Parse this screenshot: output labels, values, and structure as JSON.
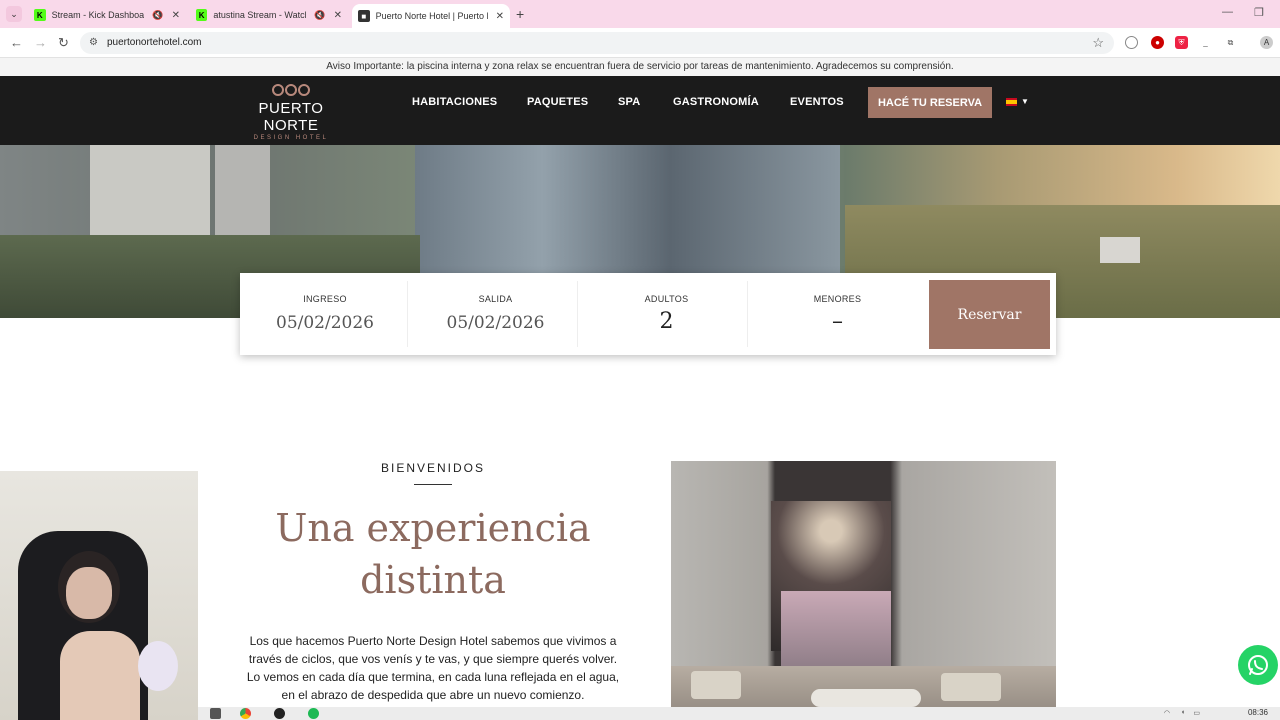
{
  "browser": {
    "tabs": [
      {
        "title": "Stream - Kick Dashboard",
        "favicon": "kick-icon",
        "active": false
      },
      {
        "title": "atustina Stream - Watch Liv",
        "favicon": "kick-icon",
        "active": false
      },
      {
        "title": "Puerto Norte Hotel | Puerto No",
        "favicon": "hotel-icon",
        "active": true
      }
    ],
    "url": "puertonortehotel.com"
  },
  "notice": "Aviso Importante: la piscina interna y zona relax se encuentran fuera de servicio por tareas de mantenimiento. Agradecemos su comprensión.",
  "header": {
    "logo_name": "PUERTO NORTE",
    "logo_sub": "DESIGN HOTEL",
    "nav": [
      "HABITACIONES",
      "PAQUETES",
      "SPA",
      "GASTRONOMÍA",
      "EVENTOS"
    ],
    "cta": "HACÉ TU RESERVA",
    "language": "es"
  },
  "booking": {
    "checkin_label": "INGRESO",
    "checkin_value": "05/02/2026",
    "checkout_label": "SALIDA",
    "checkout_value": "05/02/2026",
    "adults_label": "ADULTOS",
    "adults_value": "2",
    "children_label": "MENORES",
    "children_value": "–",
    "reserve_label": "Reservar"
  },
  "welcome": {
    "kicker": "BIENVENIDOS",
    "headline_line1": "Una experiencia",
    "headline_line2": "distinta",
    "body_line1": "Los que hacemos Puerto Norte Design Hotel sabemos que vivimos a",
    "body_line2": "través de ciclos, que vos venís y te vas, y que siempre querés volver.",
    "body_line3": "Lo vemos en cada día que termina, en cada luna reflejada en el agua,",
    "body_line4": "en el abrazo de despedida que abre un nuevo comienzo."
  },
  "taskbar": {
    "clock": "08:36"
  },
  "colors": {
    "accent": "#a07566",
    "header_bg": "#1b1b1b",
    "headline": "#8c6a5f",
    "whatsapp": "#25d366"
  }
}
